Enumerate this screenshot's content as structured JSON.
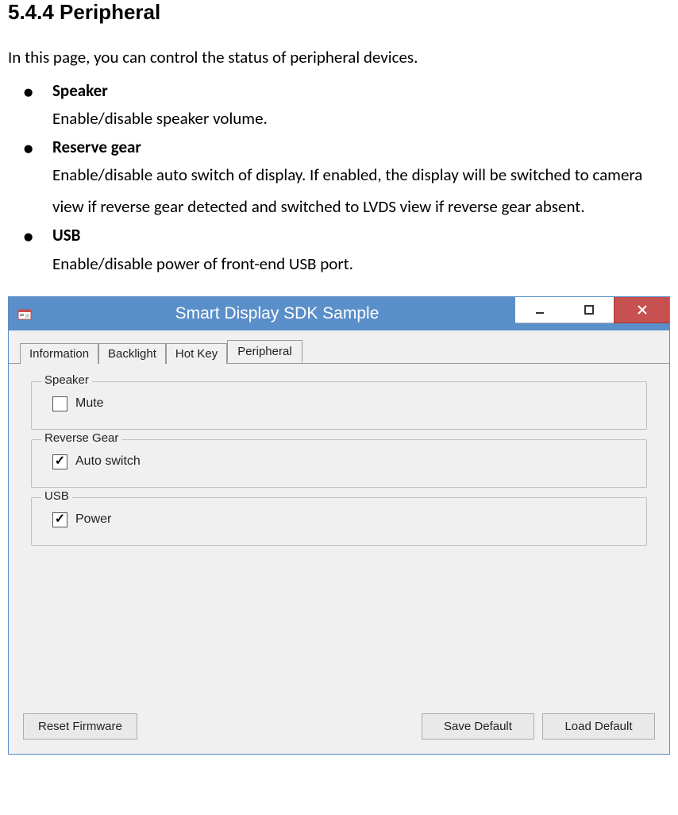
{
  "doc": {
    "heading": "5.4.4 Peripheral",
    "intro": "In this page, you can control the status of peripheral devices.",
    "bullets": [
      {
        "title": "Speaker",
        "desc": "Enable/disable speaker volume."
      },
      {
        "title": "Reserve gear",
        "desc": "Enable/disable auto switch of display. If enabled, the display will be switched to camera view if reverse gear detected and switched to LVDS view if reverse gear absent."
      },
      {
        "title": "USB",
        "desc": "Enable/disable power of front-end USB port."
      }
    ]
  },
  "window": {
    "title": "Smart Display SDK Sample",
    "tabs": [
      "Information",
      "Backlight",
      "Hot Key",
      "Peripheral"
    ],
    "active_tab": "Peripheral",
    "groups": {
      "speaker": {
        "title": "Speaker",
        "checkbox_label": "Mute",
        "checked": false
      },
      "reverse_gear": {
        "title": "Reverse Gear",
        "checkbox_label": "Auto switch",
        "checked": true
      },
      "usb": {
        "title": "USB",
        "checkbox_label": "Power",
        "checked": true
      }
    },
    "buttons": {
      "reset": "Reset Firmware",
      "save": "Save Default",
      "load": "Load Default"
    }
  }
}
